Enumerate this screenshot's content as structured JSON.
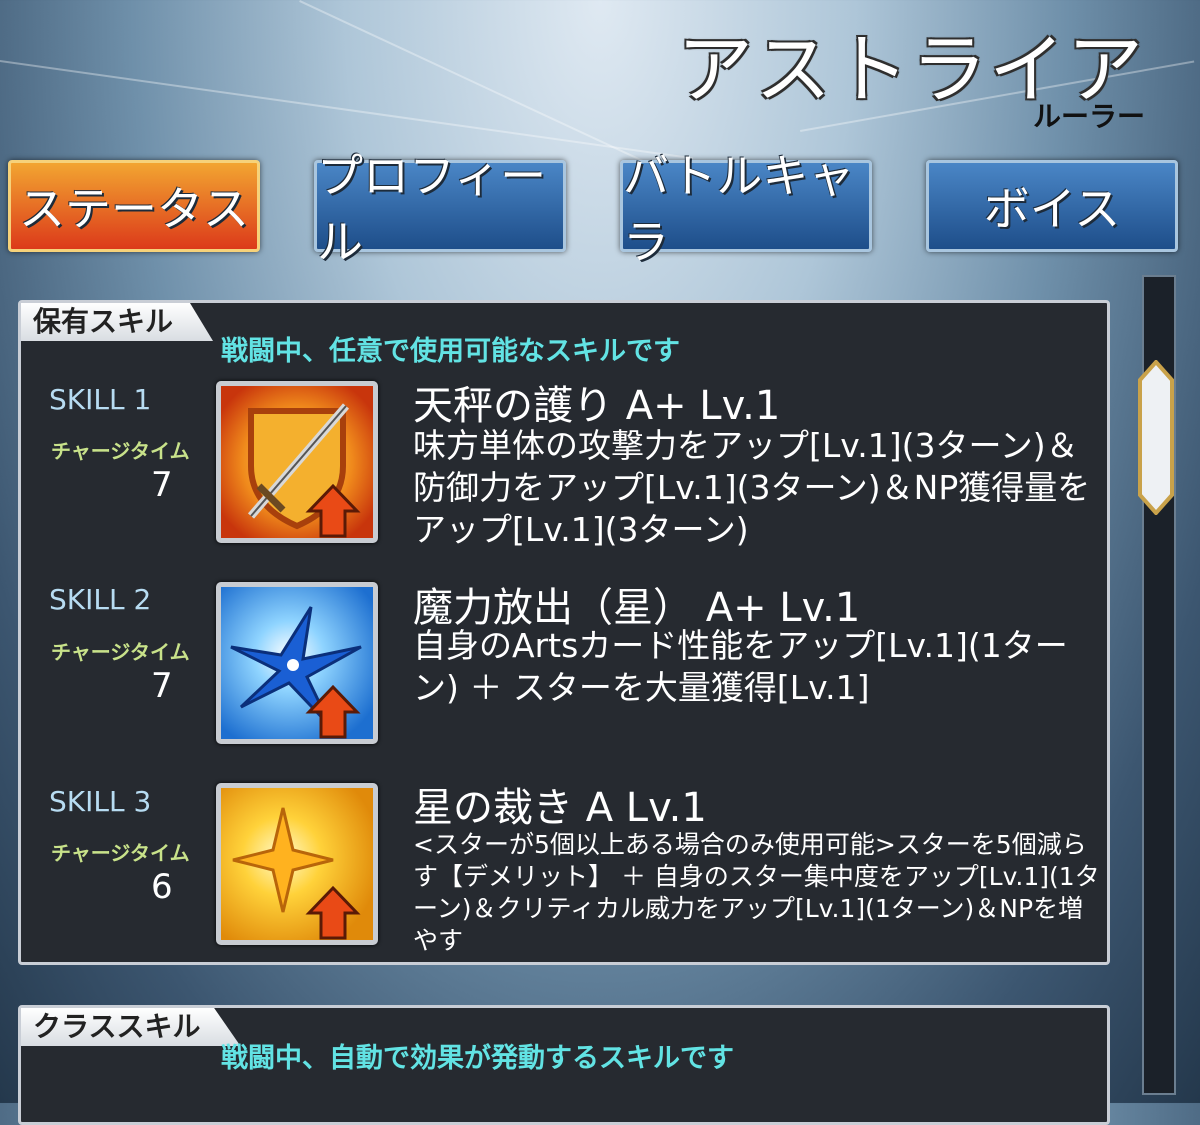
{
  "header": {
    "title": "アストライア",
    "class_name": "ルーラー"
  },
  "tabs": [
    {
      "label": "ステータス",
      "active": true
    },
    {
      "label": "プロフィール",
      "active": false
    },
    {
      "label": "バトルキャラ",
      "active": false
    },
    {
      "label": "ボイス",
      "active": false
    }
  ],
  "owned_skills": {
    "title": "保有スキル",
    "description": "戦闘中、任意で使用可能なスキルです",
    "charge_label": "チャージタイム",
    "skills": [
      {
        "slot": "SKILL 1",
        "charge_time": "7",
        "name": "天秤の護り A+ Lv.1",
        "description": "味方単体の攻撃力をアップ[Lv.1](3ターン)＆防御力をアップ[Lv.1](3ターン)＆NP獲得量をアップ[Lv.1](3ターン)",
        "icon": "shield-sword-icon"
      },
      {
        "slot": "SKILL 2",
        "charge_time": "7",
        "name": "魔力放出（星） A+ Lv.1",
        "description": "自身のArtsカード性能をアップ[Lv.1](1ターン) ＋ スターを大量獲得[Lv.1]",
        "icon": "blue-burst-icon"
      },
      {
        "slot": "SKILL 3",
        "charge_time": "6",
        "name": "星の裁き A Lv.1",
        "description": "<スターが5個以上ある場合のみ使用可能>スターを5個減らす【デメリット】 ＋ 自身のスター集中度をアップ[Lv.1](1ターン)＆クリティカル威力をアップ[Lv.1](1ターン)＆NPを増やす",
        "icon": "gold-star-icon"
      }
    ]
  },
  "class_skills": {
    "title": "クラススキル",
    "description": "戦闘中、自動で効果が発動するスキルです"
  },
  "colors": {
    "active_tab": "#dc3a1a",
    "tab": "#1e4e8a",
    "description_text": "#62e3e4",
    "charge_label": "#c8e28a"
  }
}
